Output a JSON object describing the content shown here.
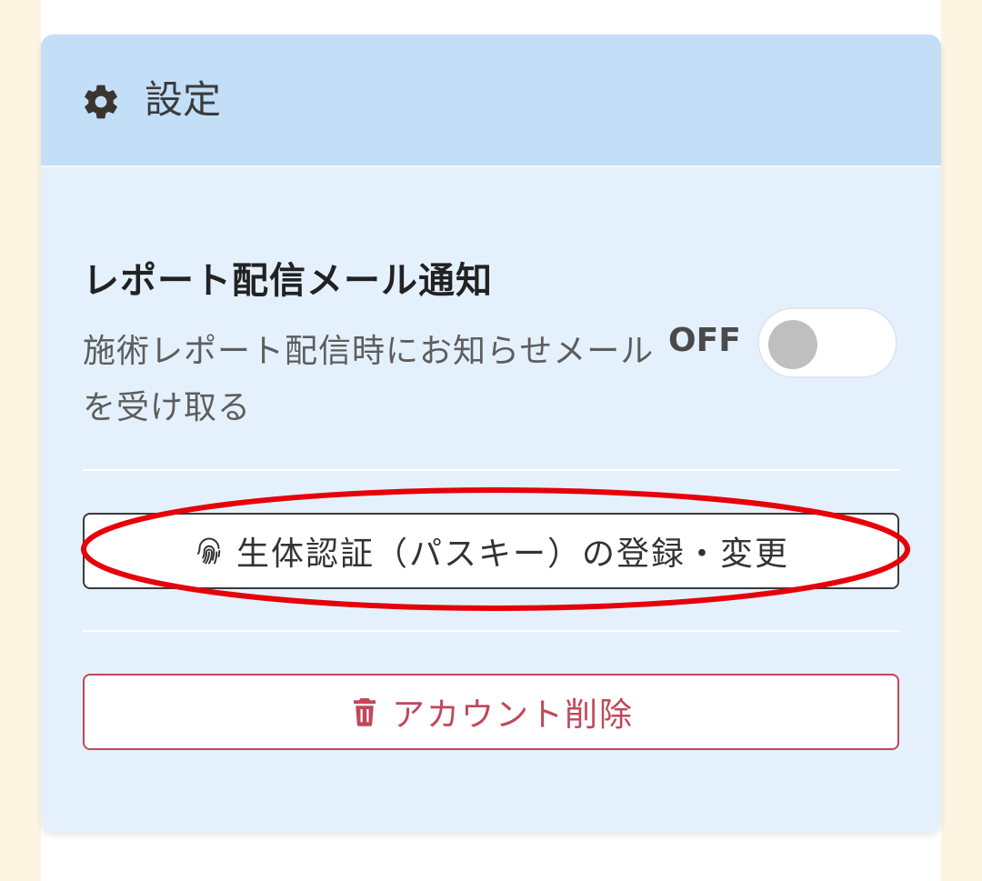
{
  "header": {
    "icon": "gear-icon",
    "title": "設定"
  },
  "report_notification": {
    "title": "レポート配信メール通知",
    "description": "施術レポート配信時にお知らせメールを受け取る",
    "toggle_state_label": "OFF",
    "toggle_on": false
  },
  "passkey_button": {
    "icon": "fingerprint-icon",
    "label": "生体認証（パスキー）の登録・変更"
  },
  "delete_button": {
    "icon": "trash-icon",
    "label": "アカウント削除"
  },
  "colors": {
    "header_bg": "#c3def7",
    "card_bg": "#e4f1fc",
    "danger": "#c0485a",
    "highlight": "#e6000a"
  }
}
